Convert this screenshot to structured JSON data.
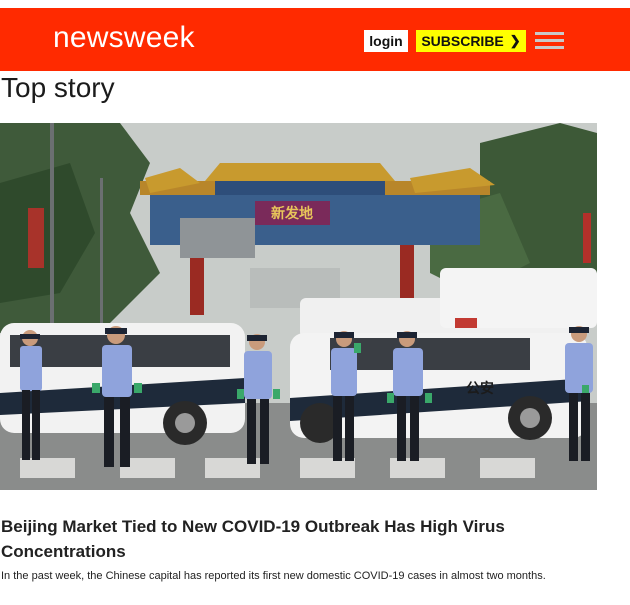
{
  "header": {
    "logo": "newsweek",
    "login_label": "login",
    "subscribe_label": "SUBSCRIBE",
    "subscribe_icon": "chevron-right-icon",
    "menu_icon": "hamburger-menu-icon",
    "colors": {
      "bar": "#ff2a00",
      "subscribe_bg": "#ffff00"
    }
  },
  "section": {
    "title": "Top story"
  },
  "story": {
    "image_icon": "photo-beijing-market-police",
    "gate_sign": "新发地",
    "car_label": "公安",
    "headline": "Beijing Market Tied to New COVID-19 Outbreak Has High Virus Concentrations",
    "summary": "In the past week, the Chinese capital has reported its first new domestic COVID-19 cases in almost two months."
  }
}
